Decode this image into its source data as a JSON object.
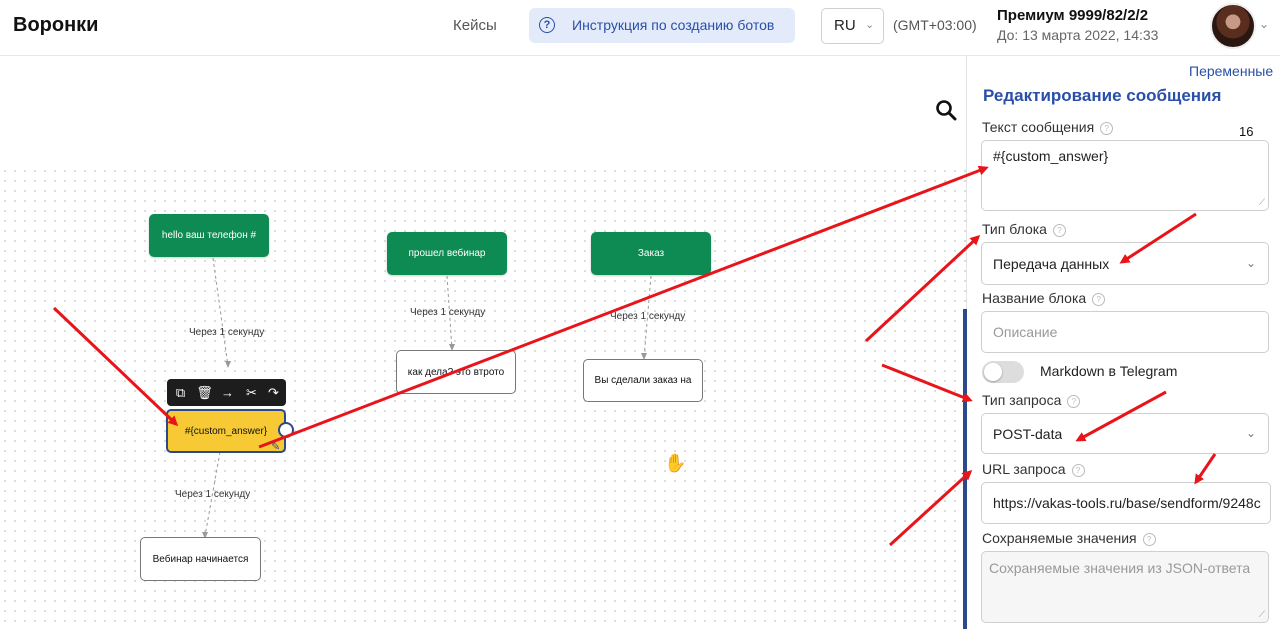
{
  "header": {
    "title": "Воронки",
    "nav_cases": "Кейсы",
    "help_label": "Инструкция по созданию ботов",
    "lang": "RU",
    "timezone": "(GMT+03:00)",
    "plan": "Премиум 9999/82/2/2",
    "plan_expiry": "До: 13 марта 2022, 14:33"
  },
  "canvas": {
    "nodes": [
      {
        "label": "hello  ваш телефон #"
      },
      {
        "label": "прошел вебинар"
      },
      {
        "label": "Заказ"
      },
      {
        "label": "#{custom_answer}"
      },
      {
        "label": "как дела? это втрото"
      },
      {
        "label": "Вы сделали заказ на"
      },
      {
        "label": "Вебинар начинается"
      }
    ],
    "edge_labels": [
      "Через 1 секунду",
      "Через 1 секунду",
      "Через 1 секунду",
      "Через 1 секунду"
    ],
    "accent": "#0e8b53",
    "selected_color": "#f6c935"
  },
  "panel": {
    "variables_link": "Переменные",
    "title": "Редактирование сообщения",
    "message_text_label": "Текст сообщения",
    "message_text_value": "#{custom_answer}",
    "char_count": "16",
    "block_type_label": "Тип блока",
    "block_type_value": "Передача данных",
    "block_name_label": "Название блока",
    "block_name_placeholder": "Описание",
    "markdown_label": "Markdown в Telegram",
    "request_type_label": "Тип запроса",
    "request_type_value": "POST-data",
    "url_label": "URL запроса",
    "url_value": "https://vakas-tools.ru/base/sendform/9248c",
    "saved_label": "Сохраняемые значения",
    "saved_placeholder": "Сохраняемые значения из JSON-ответа",
    "accent": "#2a4fa8"
  }
}
